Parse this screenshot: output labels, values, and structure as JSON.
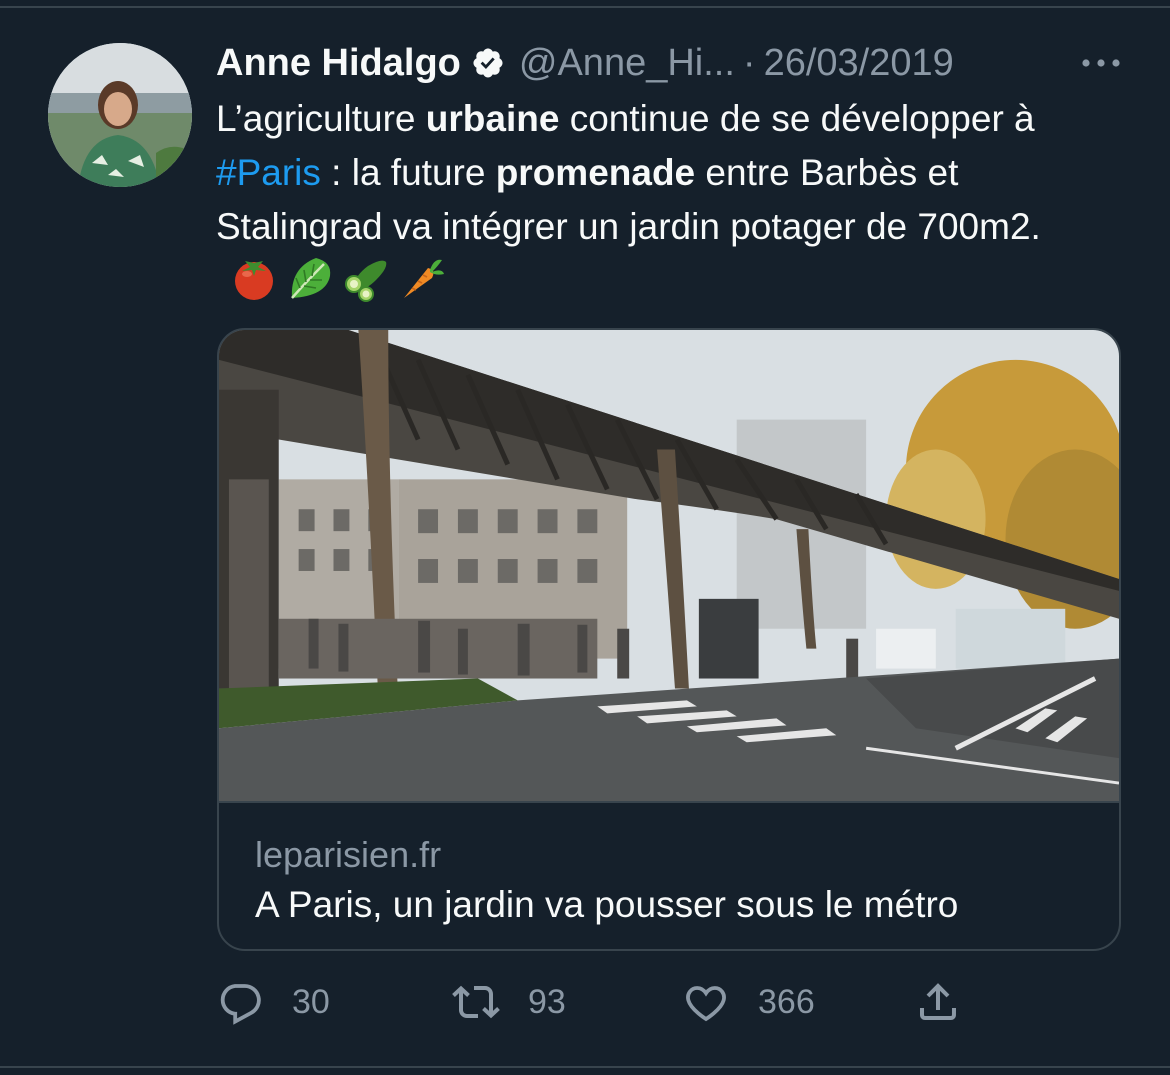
{
  "tweet": {
    "author_name": "Anne Hidalgo",
    "author_handle": "@Anne_Hi...",
    "separator": "·",
    "date": "26/03/2019",
    "text_parts": {
      "p1": "L’agriculture ",
      "p2": "urbaine",
      "p3": " continue de se développer à ",
      "hashtag": "#Paris",
      "p4": " : la future ",
      "p5": "promenade",
      "p6": " entre Barbès et Stalingrad va intégrer un jardin potager de 700m2."
    },
    "emojis": [
      "tomato-emoji",
      "leafy-green-emoji",
      "cucumber-emoji",
      "carrot-emoji"
    ]
  },
  "card": {
    "domain": "leparisien.fr",
    "title": "A Paris, un jardin va pousser sous le métro"
  },
  "actions": {
    "replies": "30",
    "retweets": "93",
    "likes": "366"
  },
  "colors": {
    "background": "#15202b",
    "text_primary": "#f7f9f9",
    "text_secondary": "#8b98a5",
    "accent": "#1d9bf0",
    "border": "#38444d"
  }
}
